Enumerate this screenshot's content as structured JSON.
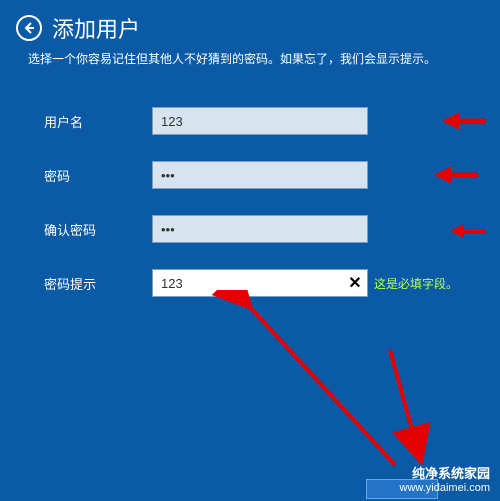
{
  "header": {
    "title": "添加用户",
    "subtitle": "选择一个你容易记住但其他人不好猜到的密码。如果忘了，我们会显示提示。"
  },
  "form": {
    "username": {
      "label": "用户名",
      "value": "123"
    },
    "password": {
      "label": "密码",
      "value": "•••"
    },
    "confirm": {
      "label": "确认密码",
      "value": "•••"
    },
    "hint": {
      "label": "密码提示",
      "value": "123",
      "message": "这是必填字段。"
    }
  },
  "icons": {
    "back": "arrow-left",
    "clear": "✕"
  },
  "colors": {
    "background": "#0b5aa5",
    "inputBg": "#d7e4f0",
    "activeInputBg": "#ffffff",
    "hintText": "#b6ff57",
    "arrow": "#e30000"
  },
  "watermark": {
    "name": "纯净系统家园",
    "url": "www.yidaimei.com"
  }
}
